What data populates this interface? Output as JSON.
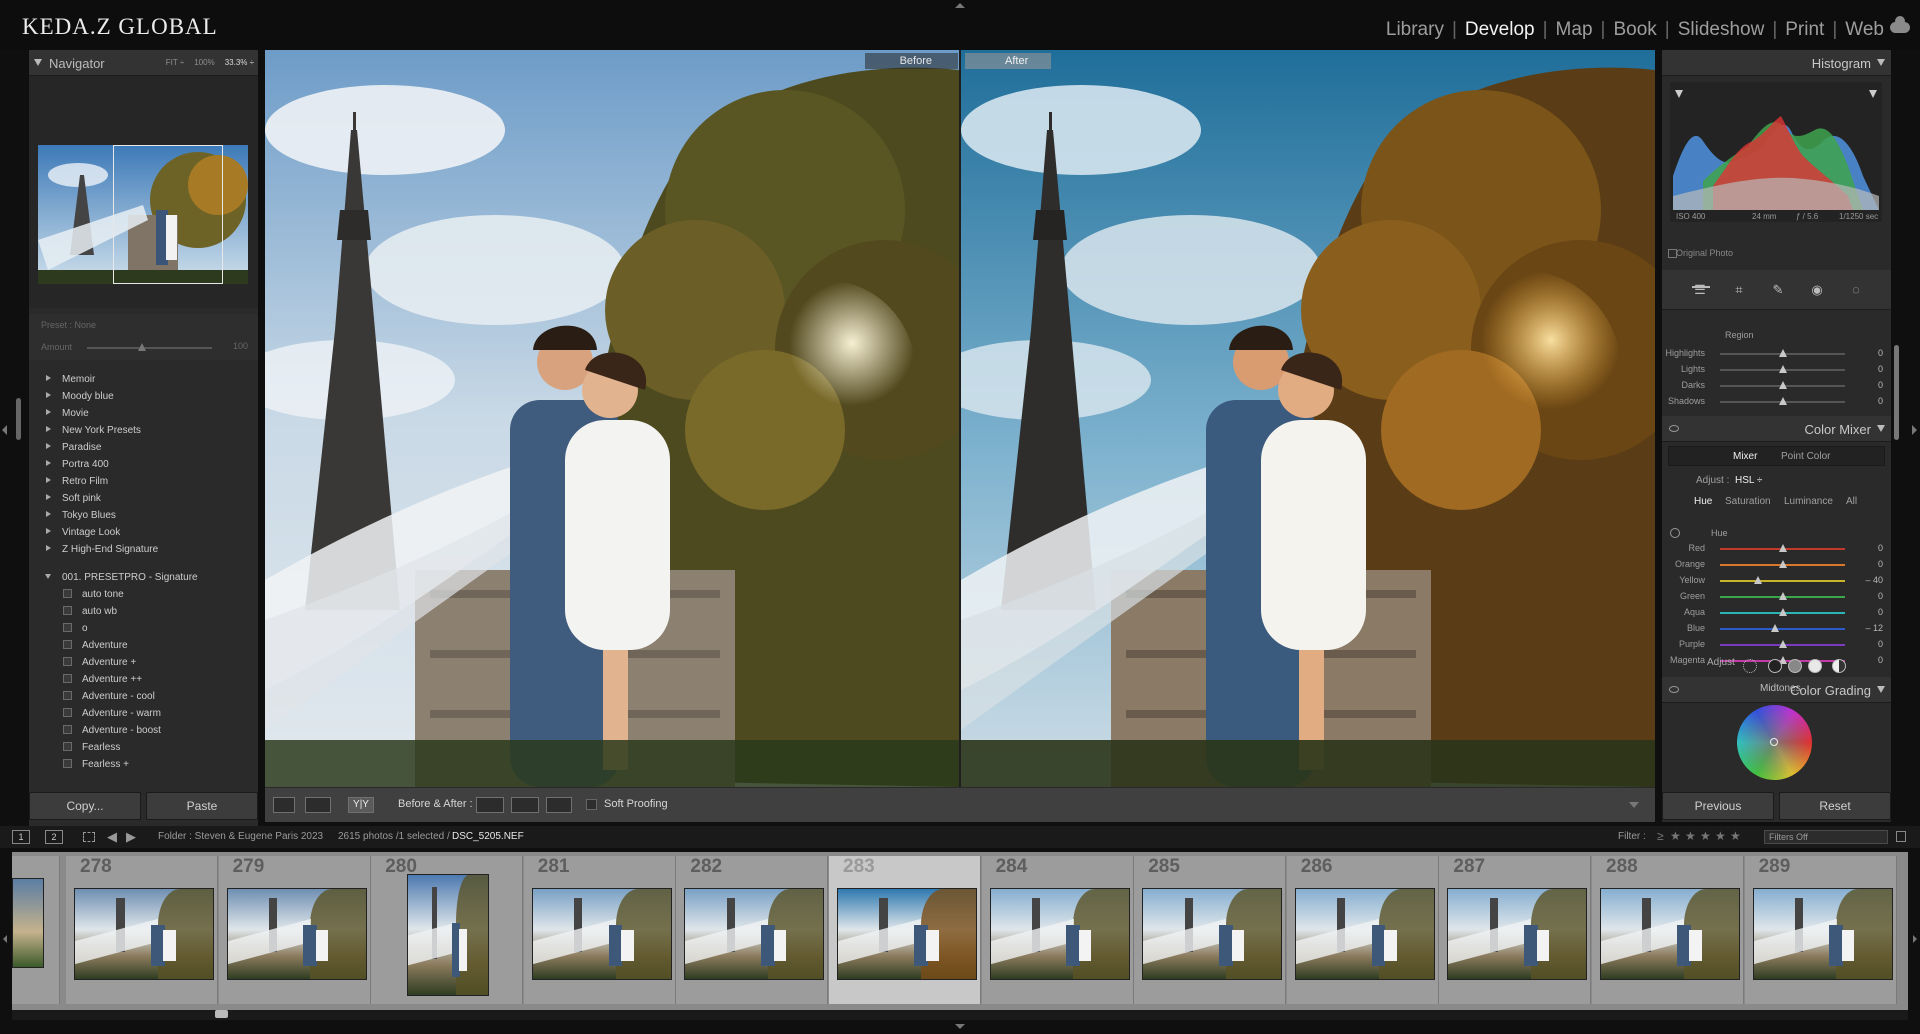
{
  "app": {
    "brand": "KEDA.Z GLOBAL",
    "modules": [
      "Library",
      "Develop",
      "Map",
      "Book",
      "Slideshow",
      "Print",
      "Web"
    ],
    "active_module": "Develop"
  },
  "navigator": {
    "title": "Navigator",
    "zoom_options": [
      "FIT ÷",
      "100%",
      "33.3% ÷"
    ],
    "active_zoom": "33.3% ÷"
  },
  "preset_amount": {
    "preset_label": "Preset : None",
    "amount_label": "Amount",
    "amount_value": "100"
  },
  "presets": {
    "folders": [
      "Memoir",
      "Moody blue",
      "Movie",
      "New York Presets",
      "Paradise",
      "Portra 400",
      "Retro Film",
      "Soft pink",
      "Tokyo Blues",
      "Vintage Look",
      "Z High-End Signature"
    ],
    "open_folder": "001. PRESETPRO - Signature",
    "items": [
      "auto tone",
      "auto wb",
      "o",
      "Adventure",
      "Adventure +",
      "Adventure ++",
      "Adventure - cool",
      "Adventure - warm",
      "Adventure - boost",
      "Fearless",
      "Fearless +"
    ]
  },
  "left_buttons": {
    "copy": "Copy...",
    "paste": "Paste"
  },
  "viewer": {
    "before_label": "Before",
    "after_label": "After"
  },
  "toolbar": {
    "before_after_label": "Before & After :",
    "soft_proofing_label": "Soft Proofing",
    "view_mode": "Y|Y"
  },
  "histogram": {
    "title": "Histogram",
    "iso": "ISO 400",
    "focal": "24 mm",
    "aperture": "ƒ / 5.6",
    "shutter": "1/1250 sec",
    "original_photo_label": "Original Photo"
  },
  "tone_curve": {
    "region_label": "Region",
    "rows": [
      {
        "name": "Highlights",
        "value": "0",
        "level": 0.5
      },
      {
        "name": "Lights",
        "value": "0",
        "level": 0.5
      },
      {
        "name": "Darks",
        "value": "0",
        "level": 0.5
      },
      {
        "name": "Shadows",
        "value": "0",
        "level": 0.5
      }
    ]
  },
  "color_mixer": {
    "title": "Color Mixer",
    "tabs": [
      "Mixer",
      "Point Color"
    ],
    "adjust_label": "Adjust :",
    "adjust_value": "HSL ÷",
    "subtabs": [
      "Hue",
      "Saturation",
      "Luminance",
      "All"
    ],
    "section_label": "Hue",
    "rows": [
      {
        "name": "Red",
        "value": "0",
        "level": 0.5,
        "color": "#c0392b"
      },
      {
        "name": "Orange",
        "value": "0",
        "level": 0.5,
        "color": "#d9772b"
      },
      {
        "name": "Yellow",
        "value": "– 40",
        "level": 0.3,
        "color": "#c9b52b"
      },
      {
        "name": "Green",
        "value": "0",
        "level": 0.5,
        "color": "#3aa84a"
      },
      {
        "name": "Aqua",
        "value": "0",
        "level": 0.5,
        "color": "#2bb5b5"
      },
      {
        "name": "Blue",
        "value": "– 12",
        "level": 0.44,
        "color": "#2b5bc9"
      },
      {
        "name": "Purple",
        "value": "0",
        "level": 0.5,
        "color": "#7a3bc0"
      },
      {
        "name": "Magenta",
        "value": "0",
        "level": 0.5,
        "color": "#c03ba6"
      }
    ]
  },
  "color_grading": {
    "title": "Color Grading",
    "adjust_label": "Adjust",
    "wheel_label": "Midtones"
  },
  "right_buttons": {
    "previous": "Previous",
    "reset": "Reset"
  },
  "filmstrip_header": {
    "screen1": "1",
    "screen2": "2",
    "folder": "Folder : Steven & Eugene Paris 2023",
    "count": "2615 photos /1 selected /",
    "file": "DSC_5205.NEF",
    "filter_label": "Filter :",
    "filters_value": "Filters Off"
  },
  "filmstrip": {
    "numbers": [
      "278",
      "279",
      "280",
      "281",
      "282",
      "283",
      "284",
      "285",
      "286",
      "287",
      "288",
      "289"
    ],
    "selected": "283"
  },
  "colors": {
    "accent_text": "#f2f2f2",
    "panel": "#2a2a2a"
  }
}
